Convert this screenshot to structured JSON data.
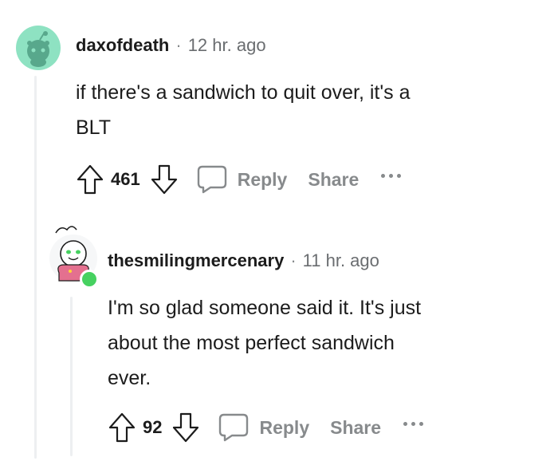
{
  "comments": [
    {
      "username": "daxofdeath",
      "separator": "·",
      "time": "12 hr. ago",
      "body_lines": [
        "if there's a sandwich to quit over, it's a",
        "BLT"
      ],
      "votes": "461",
      "reply_label": "Reply",
      "share_label": "Share"
    },
    {
      "username": "thesmilingmercenary",
      "separator": "·",
      "time": "11 hr. ago",
      "body_lines": [
        "I'm so glad someone said it. It's just",
        "about the most perfect sandwich",
        "ever."
      ],
      "votes": "92",
      "reply_label": "Reply",
      "share_label": "Share",
      "online": true
    }
  ],
  "icons": {
    "upvote": "upvote-arrow-icon",
    "downvote": "downvote-arrow-icon",
    "reply": "speech-bubble-icon",
    "more": "ellipsis-icon"
  },
  "colors": {
    "avatar_bg_1": "#8ee2c2",
    "online_dot": "#46d160",
    "action_gray": "#878a8c",
    "thread_line": "#edeff1"
  }
}
